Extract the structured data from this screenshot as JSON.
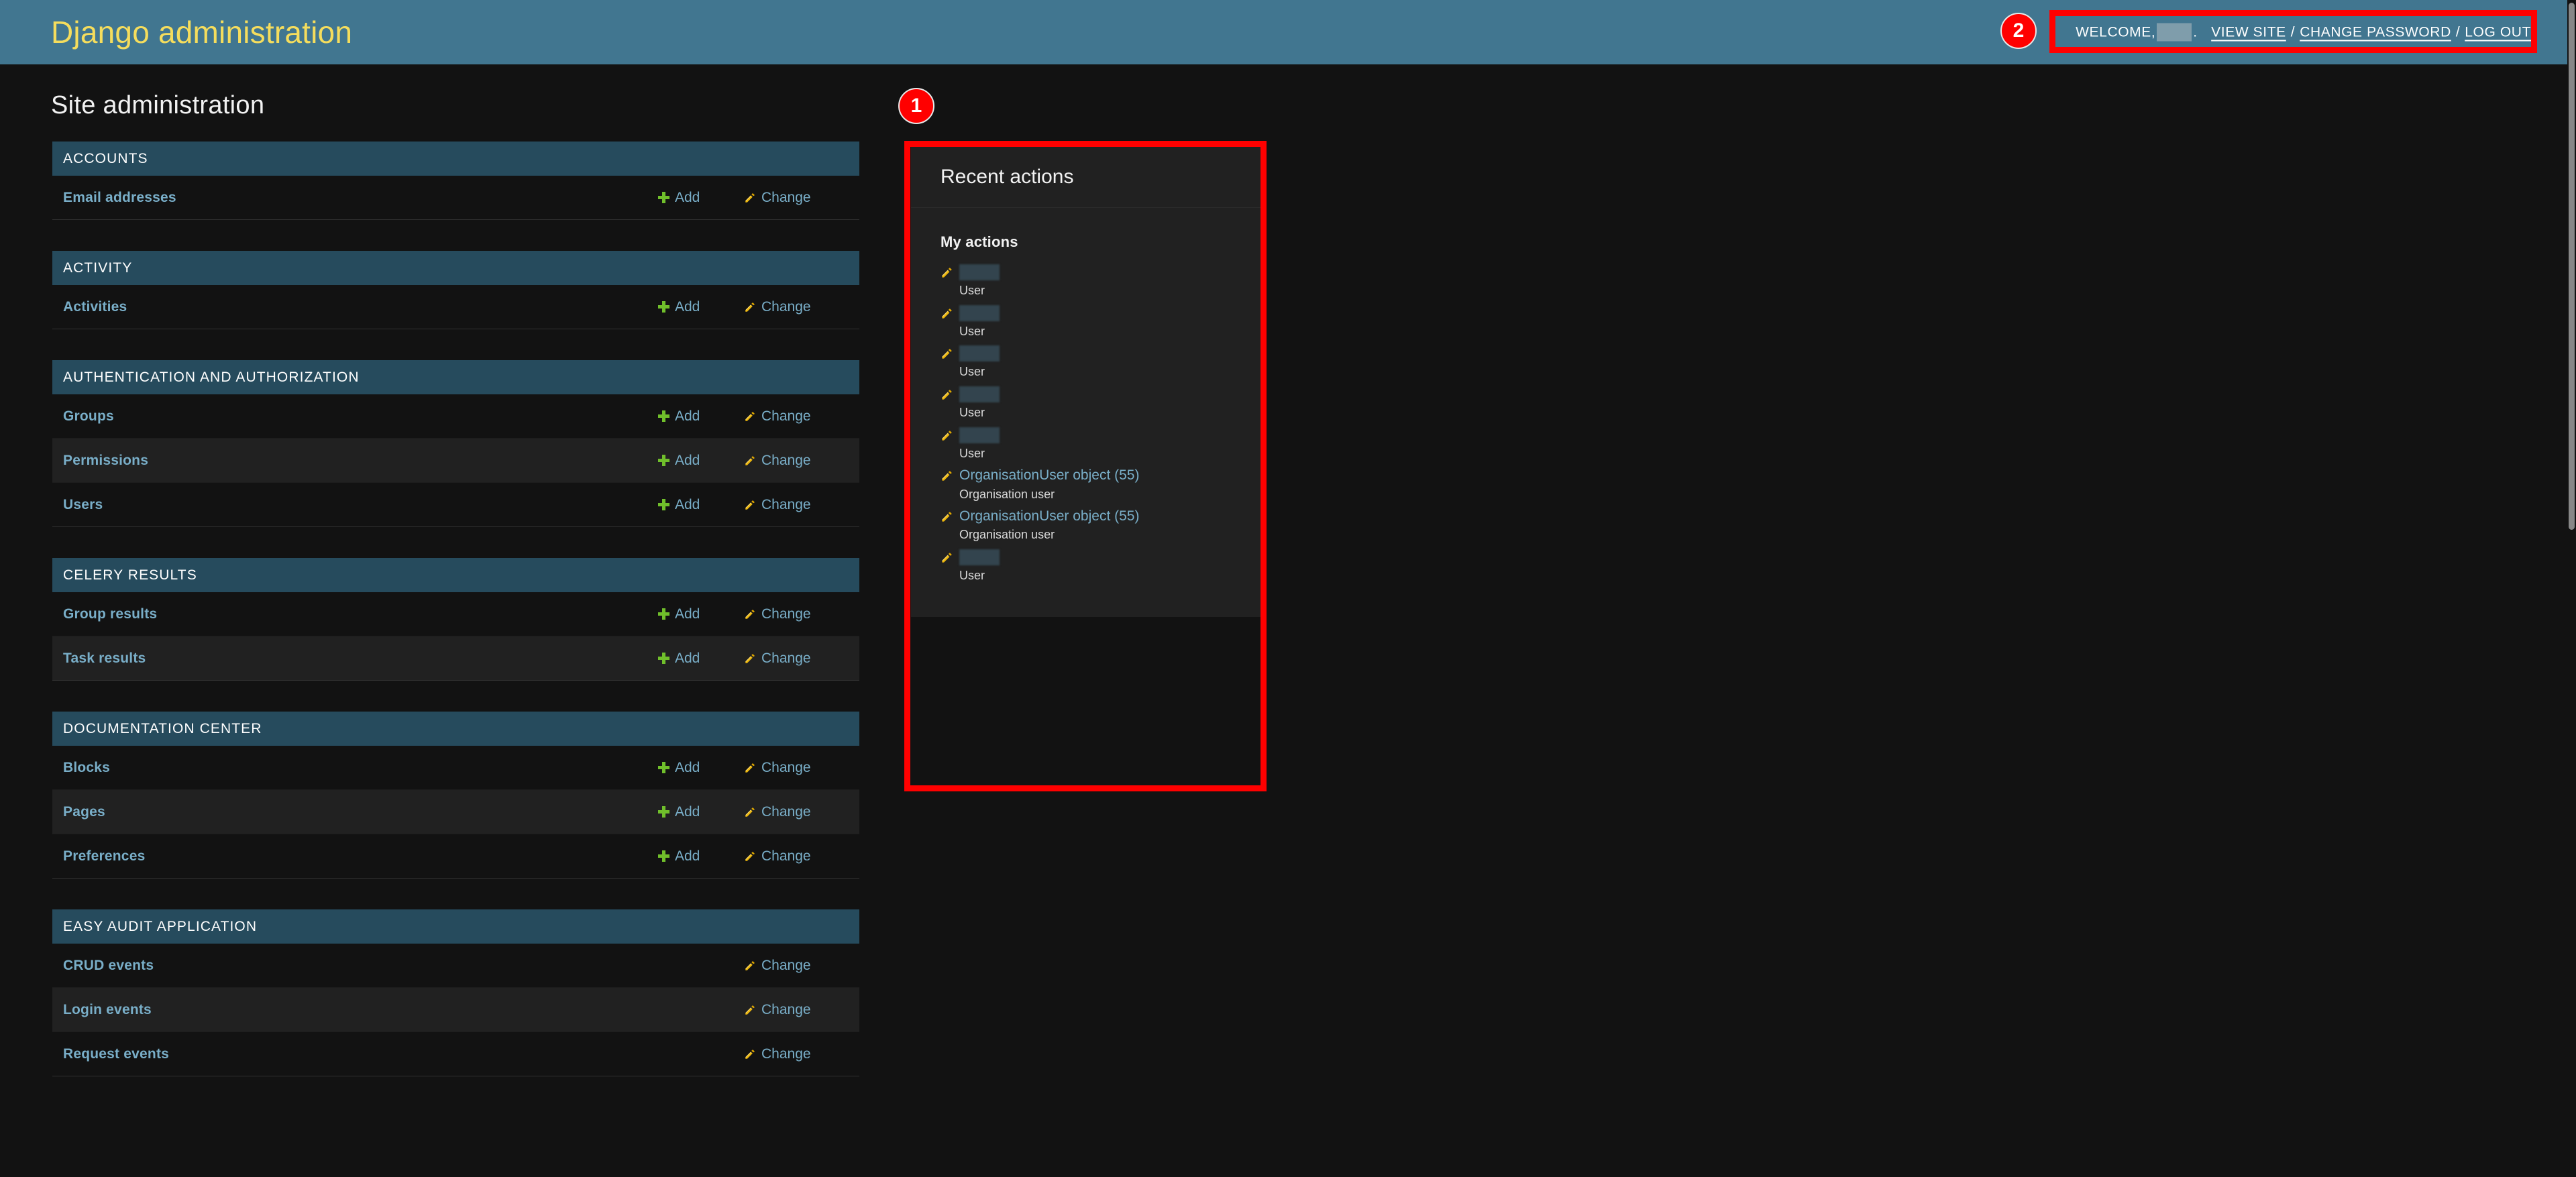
{
  "header": {
    "site_name": "Django administration",
    "welcome_label": "WELCOME,",
    "username_redacted": "",
    "period": ".",
    "links": [
      {
        "label": "VIEW SITE"
      },
      {
        "label": "CHANGE PASSWORD"
      },
      {
        "label": "LOG OUT"
      }
    ],
    "separator": "/"
  },
  "main": {
    "page_title": "Site administration",
    "add_label": "Add",
    "change_label": "Change",
    "app_modules": [
      {
        "caption": "ACCOUNTS",
        "models": [
          {
            "name": "Email addresses",
            "has_add": true,
            "has_change": true
          }
        ]
      },
      {
        "caption": "ACTIVITY",
        "models": [
          {
            "name": "Activities",
            "has_add": true,
            "has_change": true
          }
        ]
      },
      {
        "caption": "AUTHENTICATION AND AUTHORIZATION",
        "models": [
          {
            "name": "Groups",
            "has_add": true,
            "has_change": true
          },
          {
            "name": "Permissions",
            "has_add": true,
            "has_change": true
          },
          {
            "name": "Users",
            "has_add": true,
            "has_change": true
          }
        ]
      },
      {
        "caption": "CELERY RESULTS",
        "models": [
          {
            "name": "Group results",
            "has_add": true,
            "has_change": true
          },
          {
            "name": "Task results",
            "has_add": true,
            "has_change": true
          }
        ]
      },
      {
        "caption": "DOCUMENTATION CENTER",
        "models": [
          {
            "name": "Blocks",
            "has_add": true,
            "has_change": true
          },
          {
            "name": "Pages",
            "has_add": true,
            "has_change": true
          },
          {
            "name": "Preferences",
            "has_add": true,
            "has_change": true
          }
        ]
      },
      {
        "caption": "EASY AUDIT APPLICATION",
        "models": [
          {
            "name": "CRUD events",
            "has_add": false,
            "has_change": true
          },
          {
            "name": "Login events",
            "has_add": false,
            "has_change": true
          },
          {
            "name": "Request events",
            "has_add": false,
            "has_change": true
          }
        ]
      }
    ]
  },
  "recent_actions": {
    "title": "Recent actions",
    "subtitle": "My actions",
    "items": [
      {
        "label": "",
        "redacted": true,
        "content_type": "User",
        "width": 40
      },
      {
        "label": "",
        "redacted": true,
        "content_type": "User",
        "width": 34
      },
      {
        "label": "",
        "redacted": true,
        "content_type": "User",
        "width": 32
      },
      {
        "label": "",
        "redacted": true,
        "content_type": "User",
        "width": 36
      },
      {
        "label": "",
        "redacted": true,
        "content_type": "User",
        "width": 40
      },
      {
        "label": "OrganisationUser object (55)",
        "redacted": false,
        "content_type": "Organisation user"
      },
      {
        "label": "OrganisationUser object (55)",
        "redacted": false,
        "content_type": "Organisation user"
      },
      {
        "label": "",
        "redacted": true,
        "content_type": "User",
        "width": 40
      }
    ]
  },
  "annotations": [
    {
      "number": "1",
      "target": "recent-actions-panel"
    },
    {
      "number": "2",
      "target": "user-tools"
    }
  ],
  "colors": {
    "header_bg": "#417690",
    "site_name": "#f5dd5d",
    "section_header_bg": "#264b5d",
    "link_blue": "#79aec8",
    "add_green": "#70bf2b",
    "pencil_yellow": "#efb80b",
    "page_bg": "#121212",
    "annotation_red": "#ff0000"
  }
}
